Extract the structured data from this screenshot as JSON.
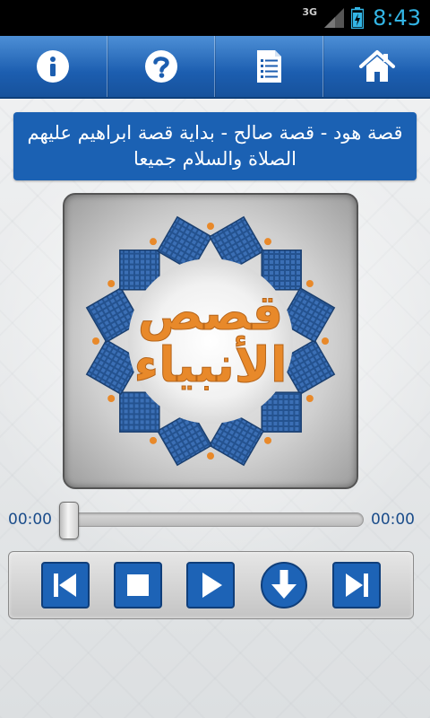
{
  "status_bar": {
    "network": "3G",
    "time": "8:43",
    "icons": [
      "signal-icon",
      "battery-charging-icon"
    ]
  },
  "toolbar": {
    "buttons": [
      {
        "name": "info",
        "icon": "info-icon"
      },
      {
        "name": "help",
        "icon": "question-icon"
      },
      {
        "name": "list",
        "icon": "document-list-icon"
      },
      {
        "name": "home",
        "icon": "home-icon"
      }
    ]
  },
  "track": {
    "title": "قصة هود - قصة صالح - بداية قصة ابراهيم عليهم الصلاة والسلام جميعا"
  },
  "cover": {
    "line1": "قصص",
    "line2": "الأنبياء"
  },
  "player": {
    "elapsed": "00:00",
    "duration": "00:00",
    "progress": 0
  },
  "controls": [
    {
      "name": "previous",
      "icon": "skip-previous-icon"
    },
    {
      "name": "stop",
      "icon": "stop-icon"
    },
    {
      "name": "play",
      "icon": "play-icon"
    },
    {
      "name": "download",
      "icon": "download-icon"
    },
    {
      "name": "next",
      "icon": "skip-next-icon"
    }
  ],
  "colors": {
    "accent": "#1b61b3",
    "toolbar_top": "#4d8fd6",
    "cover_text": "#e8892a",
    "status_time": "#33b5e5"
  }
}
